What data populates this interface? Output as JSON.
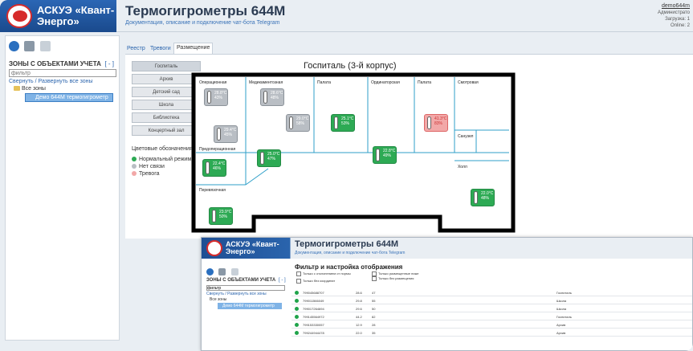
{
  "header": {
    "logo_text_1": "АСКУЭ «Квант-",
    "logo_text_2": "Энерго»",
    "title": "Термогигрометры 644М",
    "subtitle": "Документация, описание и подключение чат-бота Telegram",
    "user": "demo644m",
    "role": "Администрато",
    "load_label": "Загрузка: 1",
    "status": "Online: 2"
  },
  "sidebar": {
    "zones_title": "ЗОНЫ С ОБЪЕКТАМИ УЧЕТА",
    "zones_toggle": "[ - ]",
    "filter_placeholder": "фильтр",
    "collapse_link": "Свернуть / Развернуть все зоны",
    "tree_all": "Все зоны",
    "tree_item": "Демо 644М термогигрометр"
  },
  "tabs": [
    {
      "label": "Реестр"
    },
    {
      "label": "Тревоги"
    },
    {
      "label": "Размещение"
    }
  ],
  "rooms": [
    "Госпиталь",
    "Архив",
    "Детский сад",
    "Школа",
    "Библиотека",
    "Концертный зал"
  ],
  "legend": {
    "title": "Цветовые обозначения:",
    "normal": "Нормальный режим",
    "nolink": "Нет связи",
    "alarm": "Тревога"
  },
  "colors": {
    "normal": "#2daa54",
    "nolink": "#b9bec4",
    "alarm": "#f2a8a8",
    "accent": "#2a64ad"
  },
  "plan": {
    "title": "Госпиталь (3-й корпус)",
    "rooms": {
      "r1": "Операционная",
      "r2": "Медикаментозная",
      "r3": "Палата",
      "r4": "Ординаторская",
      "r5": "Палата",
      "r6": "Смотровая",
      "r7": "Предоперационная",
      "r8": "Санузел",
      "r9": "Холл",
      "r10": "Перевязочная"
    },
    "sensors": [
      {
        "t": "28.8°C",
        "h": "43%"
      },
      {
        "t": "28.6°C",
        "h": "48%"
      },
      {
        "t": "29.0°C",
        "h": "58%"
      },
      {
        "t": "25.1°C",
        "h": "53%"
      },
      {
        "t": "41.3°C",
        "h": "83%"
      },
      {
        "t": "29.4°C",
        "h": "45%"
      },
      {
        "t": "22.4°C",
        "h": "46%"
      },
      {
        "t": "25.0°C",
        "h": "47%"
      },
      {
        "t": "22.8°C",
        "h": "49%"
      },
      {
        "t": "22.0°C",
        "h": "48%"
      },
      {
        "t": "23.9°C",
        "h": "50%"
      }
    ]
  },
  "inset": {
    "logo_text_1": "АСКУЭ «Квант-",
    "logo_text_2": "Энерго»",
    "title": "Термогигрометры 644М",
    "subtitle": "Документация, описание и подключение чат-бота Telegram",
    "zones_title": "ЗОНЫ С ОБЪЕКТАМИ УЧЕТА",
    "zones_toggle": "[ - ]",
    "filter": "фильтр",
    "collapse": "Свернуть / Развернуть все зоны",
    "all": "Все зоны",
    "item": "Демо 644М термогигрометр",
    "filter_title": "Фильтр и настройка отображения",
    "chk1": "Только с отклонением от нормы",
    "chk2": "Только размещенные ниже",
    "chk3": "Только без размещения",
    "chk4": "Только без координат",
    "rows": [
      {
        "id": "799045688707",
        "t": "28.6",
        "h": "47",
        "loc": "Госпиталь"
      },
      {
        "id": "799011566049",
        "t": "29.8",
        "h": "55",
        "loc": "Школа"
      },
      {
        "id": "799017264694",
        "t": "29.6",
        "h": "50",
        "loc": "Школа"
      },
      {
        "id": "799145564972",
        "t": "44.2",
        "h": "82",
        "loc": "Госпиталь"
      },
      {
        "id": "799153330057",
        "t": "12.9",
        "h": "28",
        "loc": "Архив"
      },
      {
        "id": "799244944478",
        "t": "22.0",
        "h": "35",
        "loc": "Архив"
      }
    ]
  }
}
